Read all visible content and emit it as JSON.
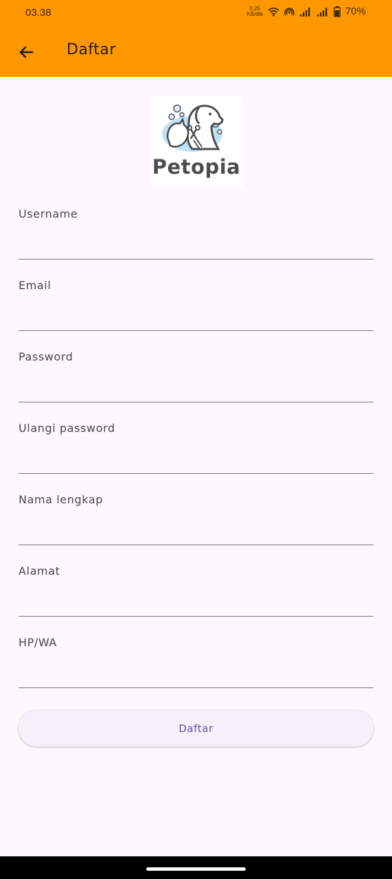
{
  "status_bar": {
    "time": "03.38",
    "net_speed_value": "0,25",
    "net_speed_unit": "KB/dtk",
    "battery": "70%",
    "icons": [
      "wifi-icon",
      "hotspot-icon",
      "signal-icon",
      "signal-icon",
      "battery-icon"
    ]
  },
  "app_bar": {
    "title": "Daftar",
    "back_icon": "arrow-left-icon"
  },
  "logo": {
    "text": "Petopia",
    "icon": "pet-grooming-logo"
  },
  "form": {
    "fields": [
      {
        "label": "Username",
        "value": ""
      },
      {
        "label": "Email",
        "value": ""
      },
      {
        "label": "Password",
        "value": ""
      },
      {
        "label": "Ulangi password",
        "value": ""
      },
      {
        "label": "Nama lengkap",
        "value": ""
      },
      {
        "label": "Alamat",
        "value": ""
      },
      {
        "label": "HP/WA",
        "value": ""
      }
    ],
    "submit_label": "Daftar"
  },
  "colors": {
    "app_bar": "#ff9800",
    "background": "#fdf8fd",
    "button_bg": "#f6f0fa",
    "button_text": "#6a4fa2",
    "underline": "#7b777b"
  }
}
